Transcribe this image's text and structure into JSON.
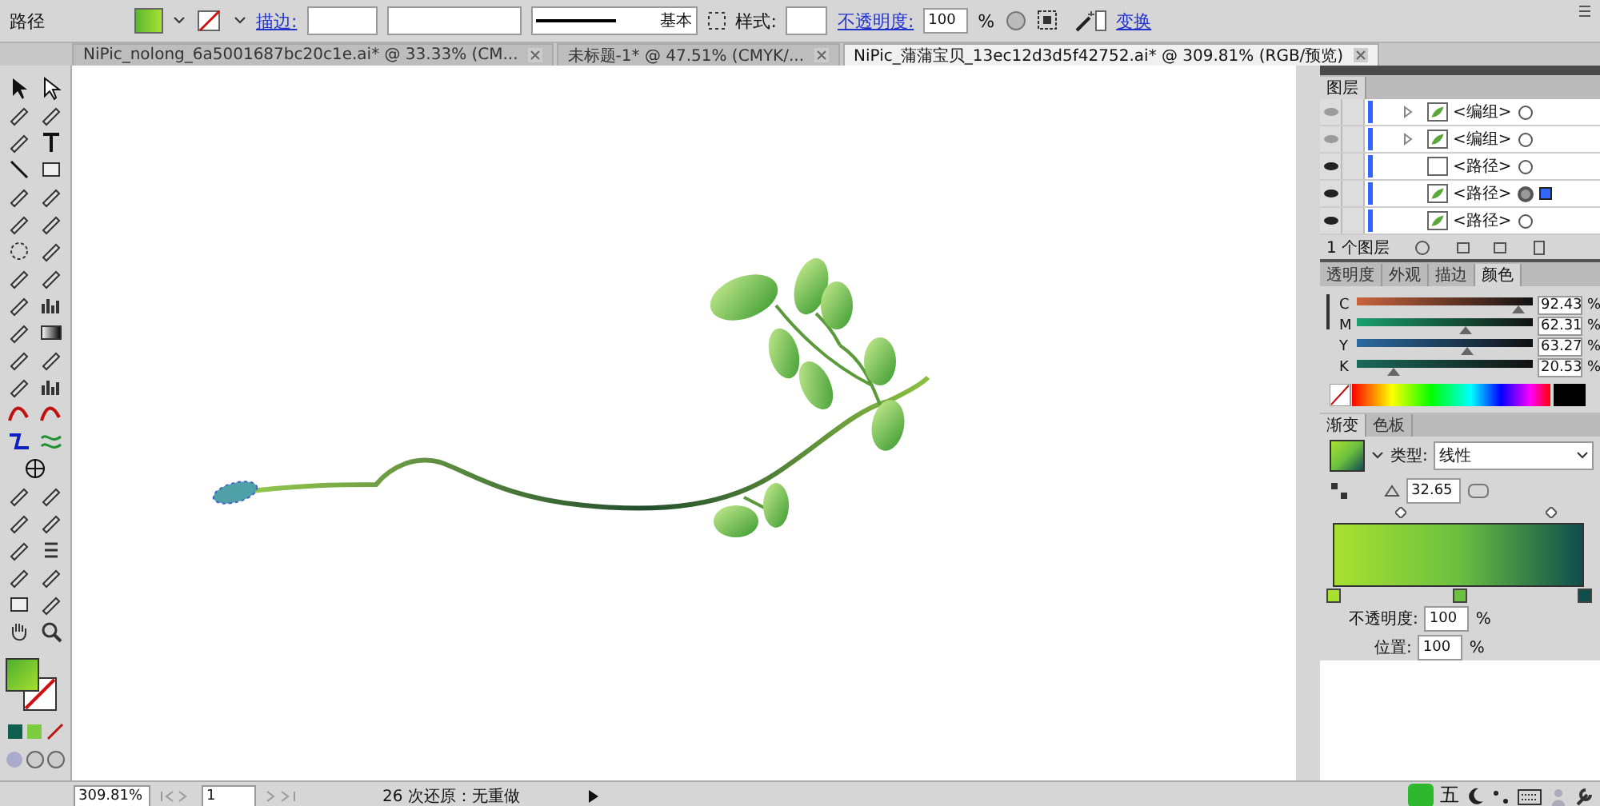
{
  "control_bar": {
    "label": "路径",
    "stroke_label": "描边:",
    "stroke_profile": "基本",
    "style_label": "样式:",
    "opacity_label": "不透明度:",
    "opacity_value": "100",
    "opacity_unit": "%",
    "transform_label": "变换"
  },
  "document_tabs": [
    {
      "title": "NiPic_nolong_6a5001687bc20c1e.ai* @ 33.33% (CM...",
      "selected": false
    },
    {
      "title": "未标题-1* @ 47.51% (CMYK/...",
      "selected": false
    },
    {
      "title": "NiPic_蒲蒲宝贝_13ec12d3d5f42752.ai* @ 309.81% (RGB/预览)",
      "selected": true
    }
  ],
  "layers_panel": {
    "title": "图层",
    "rows": [
      {
        "name": "<编组>",
        "expandable": true,
        "visible": false,
        "selected": false
      },
      {
        "name": "<编组>",
        "expandable": true,
        "visible": false,
        "selected": false
      },
      {
        "name": "<路径>",
        "expandable": false,
        "visible": true,
        "selected": false
      },
      {
        "name": "<路径>",
        "expandable": false,
        "visible": true,
        "selected": true
      },
      {
        "name": "<路径>",
        "expandable": false,
        "visible": true,
        "selected": false
      }
    ],
    "footer": "1 个图层"
  },
  "color_panel": {
    "tabs": [
      {
        "label": "透明度",
        "selected": false
      },
      {
        "label": "外观",
        "selected": false
      },
      {
        "label": "描边",
        "selected": false
      },
      {
        "label": "颜色",
        "selected": true
      }
    ],
    "channels": [
      {
        "name": "C",
        "level": 0.92,
        "value": "92.43",
        "unit": "%"
      },
      {
        "name": "M",
        "level": 0.62,
        "value": "62.31",
        "unit": "%"
      },
      {
        "name": "Y",
        "level": 0.63,
        "value": "63.27",
        "unit": "%"
      },
      {
        "name": "K",
        "level": 0.21,
        "value": "20.53",
        "unit": "%"
      }
    ]
  },
  "gradient_panel": {
    "tabs": [
      {
        "label": "渐变",
        "selected": true
      },
      {
        "label": "色板",
        "selected": false
      }
    ],
    "type_label": "类型:",
    "type_value": "线性",
    "angle": "32.65",
    "stops": [
      {
        "color": "#a8e030"
      },
      {
        "color": "#6cc040"
      },
      {
        "color": "#0f4d4d"
      }
    ],
    "opacity_label": "不透明度:",
    "opacity_value": "100",
    "opacity_unit": "%",
    "location_label": "位置:",
    "location_value": "100",
    "location_unit": "%"
  },
  "status_bar": {
    "zoom": "309.81%",
    "page": "1",
    "history": "26 次还原：无重做"
  },
  "taskbar": {
    "ime_mode": "五"
  }
}
